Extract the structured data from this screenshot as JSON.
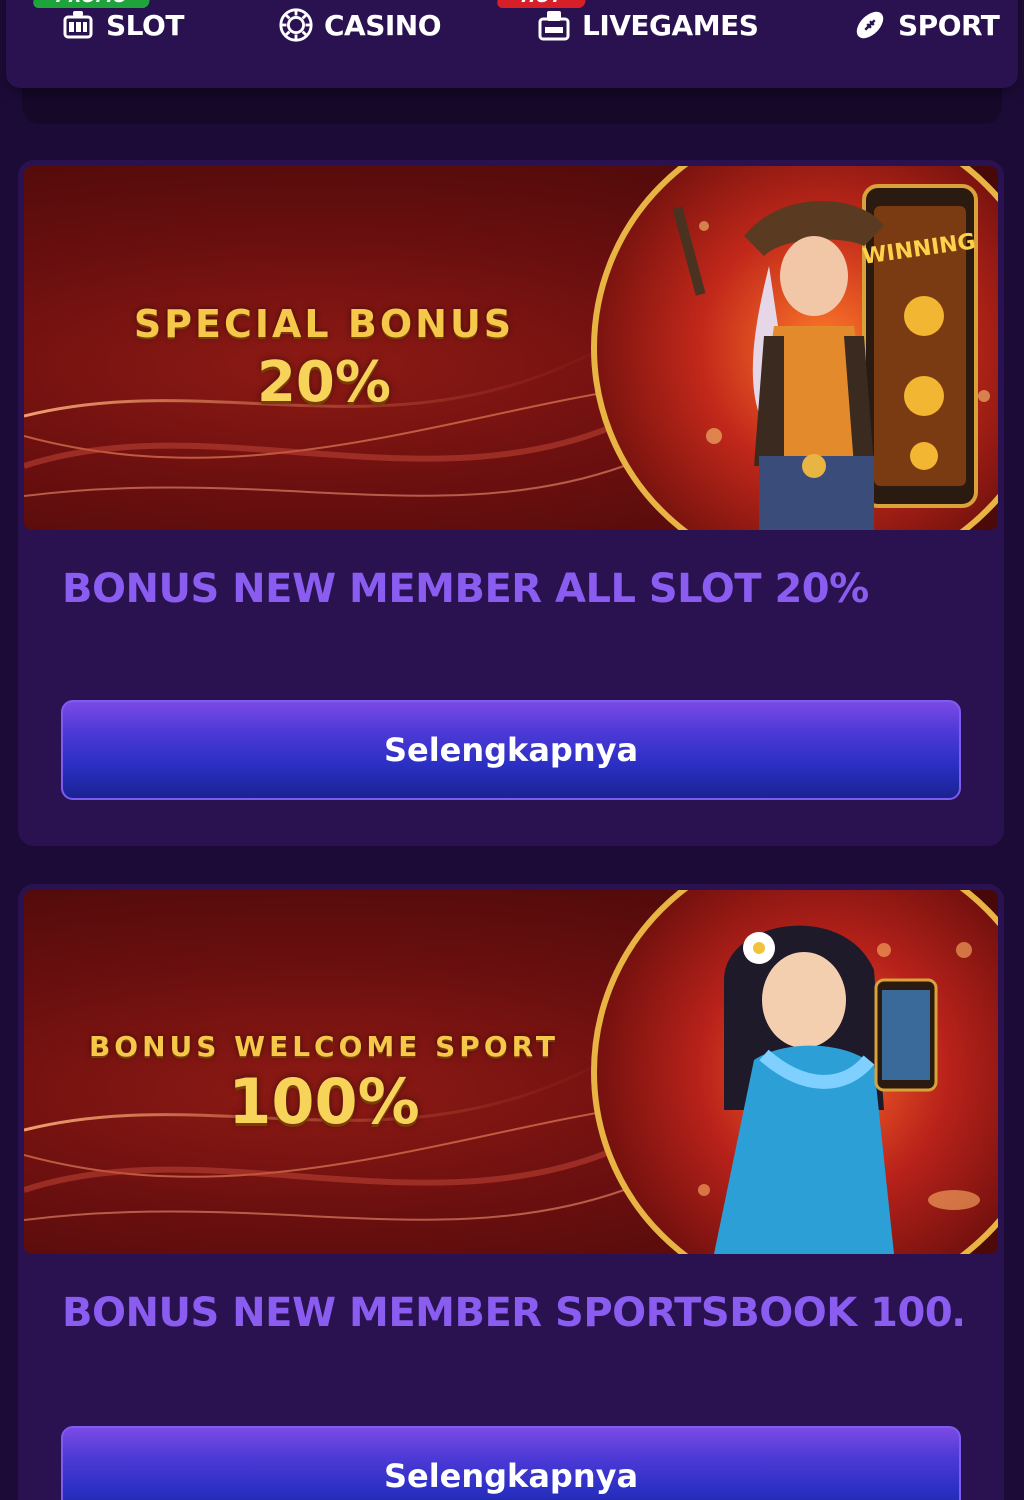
{
  "nav": {
    "items": [
      {
        "label": "SLOT",
        "icon": "slot-machine-icon"
      },
      {
        "label": "CASINO",
        "icon": "casino-chip-icon"
      },
      {
        "label": "LIVEGAMES",
        "icon": "live-tv-icon"
      },
      {
        "label": "SPORT",
        "icon": "football-icon"
      }
    ],
    "badges": {
      "promo": "PROMO",
      "hot": "HOT"
    }
  },
  "promos": [
    {
      "banner_line1": "SPECIAL BONUS",
      "banner_line2": "20%",
      "title": "BONUS NEW MEMBER ALL SLOT 20%",
      "button_label": "Selengkapnya"
    },
    {
      "banner_line1": "BONUS WELCOME SPORT",
      "banner_line2": "100%",
      "title": "BONUS NEW MEMBER SPORTSBOOK 100…",
      "button_label": "Selengkapnya"
    }
  ],
  "colors": {
    "background": "#1c0b36",
    "card": "#2a1150",
    "title_purple": "#8a5cf0",
    "gold": "#f6c84a",
    "promo_green": "#1fa43b",
    "hot_red": "#d61f26"
  }
}
